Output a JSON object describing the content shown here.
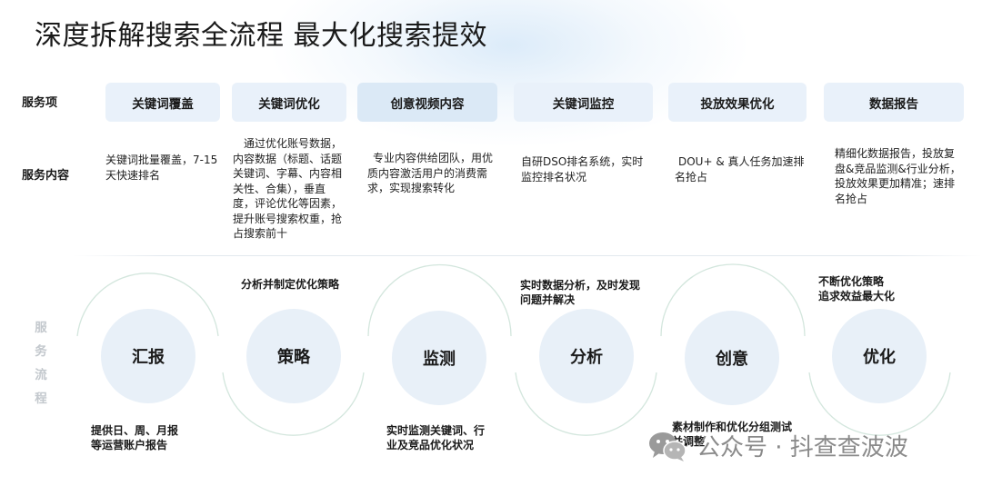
{
  "title": "深度拆解搜索全流程 最大化搜索提效",
  "labels": {
    "service_items": "服务项",
    "service_content": "服务内容",
    "service_flow": [
      "服",
      "务",
      "流",
      "程"
    ]
  },
  "items": [
    {
      "label": "关键词覆盖",
      "desc": "关键词批量覆盖，7-15天快速排名"
    },
    {
      "label": "关键词优化",
      "desc": "通过优化账号数据，内容数据（标题、话题关键词、字幕、内容相关性、合集），垂直度，评论优化等因素，提升账号搜索权重，抢占搜索前十"
    },
    {
      "label": "创意视频内容",
      "desc": "专业内容供给团队，用优质内容激活用户的消费需求，实现搜索转化"
    },
    {
      "label": "关键词监控",
      "desc": "自研DSO排名系统，实时监控排名状况"
    },
    {
      "label": "投放效果优化",
      "desc": "DOU+ & 真人任务加速排名抢占"
    },
    {
      "label": "数据报告",
      "desc": "精细化数据报告，投放复盘&竞品监测&行业分析，投放效果更加精准；速排名抢占"
    }
  ],
  "flow": [
    {
      "label": "汇报"
    },
    {
      "label": "策略"
    },
    {
      "label": "监测"
    },
    {
      "label": "分析"
    },
    {
      "label": "创意"
    },
    {
      "label": "优化"
    }
  ],
  "notes": [
    {
      "text": [
        "提供日、周、月报",
        "等运营账户报告"
      ]
    },
    {
      "text": [
        "分析并制定优化策略"
      ]
    },
    {
      "text": [
        "实时监测关键词、行",
        "业及竞品优化状况"
      ]
    },
    {
      "text": [
        "实时数据分析，及时发现",
        "问题并解决"
      ]
    },
    {
      "text": [
        "素材制作和优化分组测试",
        "并调整"
      ]
    },
    {
      "text": [
        "不断优化策略",
        "追求效益最大化"
      ]
    }
  ],
  "watermark": "公众号 · 抖查查波波",
  "colors": {
    "item_bg": "#e9f1fa",
    "circle_bg": "#e8f0f8",
    "arc": "#d3e6dd",
    "muted_label": "#c3c8cd"
  }
}
